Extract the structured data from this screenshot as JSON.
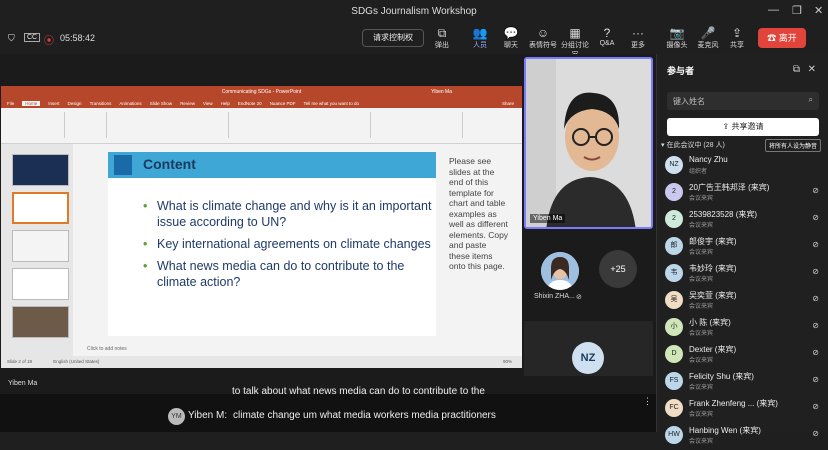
{
  "window": {
    "title": "SDGs Journalism Workshop"
  },
  "toolbar": {
    "timer": "05:58:42",
    "control_label": "请求控制权",
    "items": [
      {
        "label": "弹出",
        "icon": "popout-icon"
      },
      {
        "label": "人员",
        "icon": "people-icon"
      },
      {
        "label": "聊天",
        "icon": "chat-icon"
      },
      {
        "label": "表情符号",
        "icon": "emoji-icon"
      },
      {
        "label": "分组讨论室",
        "icon": "breakout-icon"
      },
      {
        "label": "Q&A",
        "icon": "qa-icon"
      },
      {
        "label": "更多",
        "icon": "more-icon"
      },
      {
        "label": "摄像头",
        "icon": "camera-off-icon"
      },
      {
        "label": "麦克风",
        "icon": "mic-off-icon"
      },
      {
        "label": "共享",
        "icon": "share-icon"
      }
    ],
    "leave_label": "离开"
  },
  "ppt": {
    "title": "Communicating SDGs - PowerPoint",
    "user": "Yiben Ma",
    "tabs": [
      "File",
      "Home",
      "Insert",
      "Design",
      "Transitions",
      "Animations",
      "Slide Show",
      "Review",
      "View",
      "Help",
      "EndNote 20",
      "Nuance PDF",
      "Tell me what you want to do"
    ],
    "share": "Share",
    "slide_title": "Content",
    "bullets": [
      "What is climate change and why is it an important issue according to UN?",
      "Key international agreements on climate changes",
      "What news media can do to contribute to the climate action?"
    ],
    "side_note": "Please see slides at the end of this template for chart and table examples as well as different elements. Copy and paste these items onto this page.",
    "notes_placeholder": "Click to add notes",
    "status_left": "Slide 2 of 18",
    "status_lang": "English (United States)",
    "zoom": "90%"
  },
  "video": {
    "name": "Yiben Ma"
  },
  "tiles": {
    "participant": "Shixin ZHA...",
    "more_count": "+25",
    "nz_initials": "NZ"
  },
  "panel": {
    "title": "参与者",
    "search_placeholder": "键入姓名",
    "share_invite": "共享邀请",
    "in_meeting": "在此会议中 (28 人)",
    "mute_all": "将所有人设为静音",
    "people": [
      {
        "initials": "NZ",
        "name": "Nancy Zhu",
        "role": "组织者",
        "color": "#cfe0f0"
      },
      {
        "initials": "2",
        "name": "20广告王韩邦泽 (来宾)",
        "role": "会议来宾",
        "color": "#c9c9ef"
      },
      {
        "initials": "2",
        "name": "2539823528 (来宾)",
        "role": "会议来宾",
        "color": "#cdeadb"
      },
      {
        "initials": "郎",
        "name": "郎俊宇 (来宾)",
        "role": "会议来宾",
        "color": "#bcd7ea"
      },
      {
        "initials": "韦",
        "name": "韦妙玲 (来宾)",
        "role": "会议来宾",
        "color": "#bcd7ea"
      },
      {
        "initials": "吴",
        "name": "吴奕萱 (来宾)",
        "role": "会议来宾",
        "color": "#f1dcc4"
      },
      {
        "initials": "小",
        "name": "小 陈 (来宾)",
        "role": "会议来宾",
        "color": "#cfe6b8"
      },
      {
        "initials": "D",
        "name": "Dexter (来宾)",
        "role": "会议来宾",
        "color": "#cfe6b8"
      },
      {
        "initials": "FS",
        "name": "Felicity Shu (来宾)",
        "role": "会议来宾",
        "color": "#bcd7ea"
      },
      {
        "initials": "FC",
        "name": "Frank Zhenfeng ... (来宾)",
        "role": "会议来宾",
        "color": "#f1dcc4"
      },
      {
        "initials": "HW",
        "name": "Hanbing Wen (来宾)",
        "role": "会议来宾",
        "color": "#bcd7ea"
      }
    ]
  },
  "captions": {
    "speaker_tag": "Yiben Ma",
    "line1": "to talk about what news media can do to contribute to the",
    "speaker": "Yiben M:",
    "speaker_initials": "YM",
    "line2": "climate change um what media workers media practitioners"
  }
}
